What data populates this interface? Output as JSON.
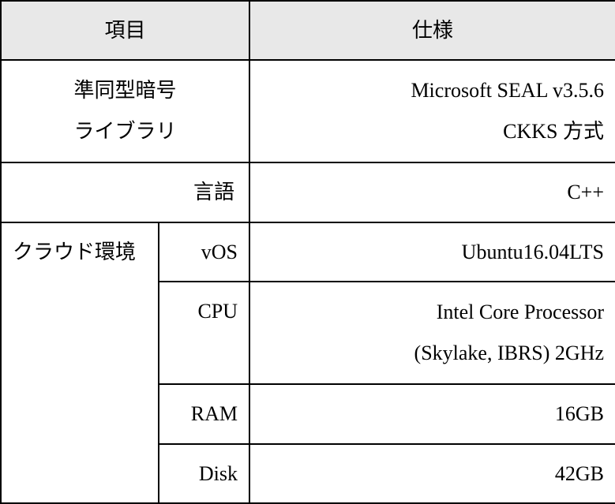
{
  "header": {
    "item": "項目",
    "spec": "仕様"
  },
  "rows": {
    "crypto_lib": {
      "label_line1": "準同型暗号",
      "label_line2": "ライブラリ",
      "value_line1": "Microsoft  SEAL  v3.5.6",
      "value_line2": "CKKS 方式"
    },
    "language": {
      "label": "言語",
      "value": "C++"
    },
    "cloud": {
      "label": "クラウド環境",
      "vos": {
        "label": "vOS",
        "value": "Ubuntu16.04LTS"
      },
      "cpu": {
        "label": "CPU",
        "value_line1": "Intel  Core  Processor",
        "value_line2": "(Skylake, IBRS) 2GHz"
      },
      "ram": {
        "label": "RAM",
        "value": "16GB"
      },
      "disk": {
        "label": "Disk",
        "value": "42GB"
      }
    }
  }
}
